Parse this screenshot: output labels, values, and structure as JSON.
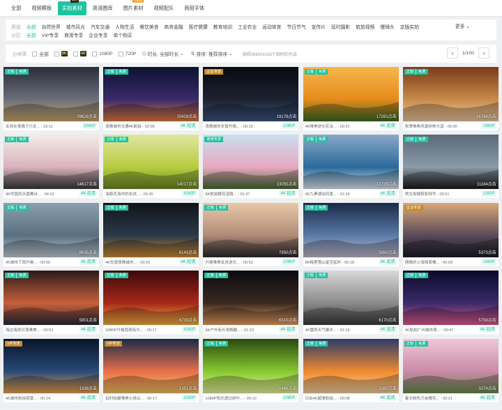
{
  "top_tabs": [
    {
      "label": "全部",
      "active": false
    },
    {
      "label": "视频模板",
      "active": false
    },
    {
      "label": "实拍素材",
      "active": true,
      "badge": "8K"
    },
    {
      "label": "高清图库",
      "active": false
    },
    {
      "label": "图片素材",
      "active": false,
      "badge_new": "上新啦"
    },
    {
      "label": "视频配乐",
      "active": false
    },
    {
      "label": "商用字体",
      "active": false
    }
  ],
  "filter": {
    "category_label": "用途:",
    "categories": [
      "全部",
      "自然世界",
      "城市风光",
      "汽车交通",
      "人物生活",
      "餐饮美食",
      "商务金融",
      "医疗健康",
      "教育培训",
      "工业农业",
      "运动体育",
      "节日节气",
      "宣传片",
      "延时摄影",
      "航拍视频",
      "慢镜头",
      "定版实拍"
    ],
    "more_label": "更多",
    "area_label": "分区:",
    "areas": [
      "全部",
      "VIP专享",
      "商用专享",
      "企业专享",
      "单个购买"
    ]
  },
  "options": {
    "res_label": "分辨率:",
    "res_all": "全部",
    "res_8k": "8K",
    "res_4k": "4K",
    "res_1080": "1080P",
    "res_720": "720P",
    "duration": "时长: 全部时长",
    "sort": "排序: 推荐排序",
    "count_text": "按照366054156个相同的作品",
    "page": "1/100",
    "prev_icon": "‹",
    "next_icon": "›"
  },
  "cards": [
    {
      "tags": [
        "正版",
        "免费"
      ],
      "clicks": "29628点击",
      "title": "女孩在夜晚下行走...",
      "duration": "02:11",
      "quality": "1080P"
    },
    {
      "tags": [
        "正版",
        "免费"
      ],
      "clicks": "10428点击",
      "title": "夜晚城市交通4K航拍",
      "duration": "02:09",
      "quality": "4K 超清"
    },
    {
      "tags": [
        "企业专享"
      ],
      "clicks": "19178点击",
      "title": "夜晚城市车窗升格...",
      "duration": "00:15",
      "quality": "1080P"
    },
    {
      "tags": [
        "正版",
        "免费"
      ],
      "clicks": "17281点击",
      "title": "4K唯美逆光花朵...",
      "duration": "00:22",
      "quality": "4K 超清"
    },
    {
      "tags": [
        "正版",
        "免费"
      ],
      "clicks": "16764点击",
      "title": "秋季唯美风景树林大道",
      "duration": "00:30",
      "quality": "1080P"
    },
    {
      "tags": [
        "正版",
        "免费"
      ],
      "clicks": "14617点击",
      "title": "4K中国风水墨舞台...",
      "duration": "04:10",
      "quality": "4K 超清"
    },
    {
      "tags": [
        "正版",
        "免费"
      ],
      "clicks": "14017点击",
      "title": "油菜花海中的女孩...",
      "duration": "00:30",
      "quality": "1080P"
    },
    {
      "tags": [
        "商用专享"
      ],
      "clicks": "13055点击",
      "title": "4K航拍樱花道路...",
      "duration": "01:37",
      "quality": "4K 超清"
    },
    {
      "tags": [
        "正版",
        "免费"
      ],
      "clicks": "12729点击",
      "title": "4K九寨湖泊风景...",
      "duration": "01:29",
      "quality": "4K 超清"
    },
    {
      "tags": [
        "正版",
        "免费"
      ],
      "clicks": "11184点击",
      "title": "男生吸烟剪影特写",
      "duration": "00:51",
      "quality": "1080P"
    },
    {
      "tags": [
        "正版",
        "免费"
      ],
      "clicks": "8635点击",
      "title": "4K城市下雨升格...",
      "duration": "00:50",
      "quality": "4K 超清"
    },
    {
      "tags": [
        "正版",
        "免费"
      ],
      "clicks": "8143点击",
      "title": "4K车窗夜晚城市...",
      "duration": "00:25",
      "quality": "4K 超清"
    },
    {
      "tags": [
        "正版",
        "免费"
      ],
      "clicks": "7850点击",
      "title": "升格唯美女孩逆光...",
      "duration": "00:52",
      "quality": "1080P"
    },
    {
      "tags": [
        "正版",
        "免费"
      ],
      "clicks": "5850点击",
      "title": "8K梅里雪山星空延时",
      "duration": "00:18",
      "quality": "8K 超清"
    },
    {
      "tags": [
        "企业专享"
      ],
      "clicks": "5373点击",
      "title": "傍晚的上海陆家嘴...",
      "duration": "00:09",
      "quality": "1080P"
    },
    {
      "tags": [
        "正版",
        "免费"
      ],
      "clicks": "5801点击",
      "title": "海边海浪日落唯美...",
      "duration": "00:53",
      "quality": "4K 超清"
    },
    {
      "tags": [
        "正版",
        "免费"
      ],
      "clicks": "6733点击",
      "title": "1080P升格雨夜街头...",
      "duration": "00:17",
      "quality": "1080P"
    },
    {
      "tags": [
        "正版",
        "免费"
      ],
      "clicks": "6310点击",
      "title": "4K户外街头夜晚散...",
      "duration": "01:23",
      "quality": "4K 超清"
    },
    {
      "tags": [
        "正版",
        "免费"
      ],
      "clicks": "6170点击",
      "title": "4K雷雨天气脚步...",
      "duration": "01:16",
      "quality": "4K 超清"
    },
    {
      "tags": [
        "正版",
        "免费"
      ],
      "clicks": "5758点击",
      "title": "4K航拍广州城市夜...",
      "duration": "00:47",
      "quality": "4K 超清"
    },
    {
      "tags": [
        "VIP专享"
      ],
      "clicks": "1338点击",
      "title": "4K城市航拍夜景...",
      "duration": "00:14",
      "quality": "4K 超清"
    },
    {
      "tags": [
        "VIP专享"
      ],
      "clicks": "1351点击",
      "title": "延时拍摄唯美火烧云...",
      "duration": "00:17",
      "quality": "1080P"
    },
    {
      "tags": [
        "正版",
        "免费"
      ],
      "clicks": "1466点击",
      "title": "1080P阳光透过树叶...",
      "duration": "00:10",
      "quality": "1080P"
    },
    {
      "tags": [
        "正版",
        "免费"
      ],
      "clicks": "5382点击",
      "title": "日出4K超清航拍...",
      "duration": "00:08",
      "quality": "4K 超清"
    },
    {
      "tags": [
        "正版",
        "免费"
      ],
      "clicks": "3274点击",
      "title": "春天粉色万亩樱花...",
      "duration": "00:21",
      "quality": "4K 超清"
    }
  ],
  "colors": {
    "accent": "#1fc3a0",
    "enterprise": "#c88a2a"
  }
}
